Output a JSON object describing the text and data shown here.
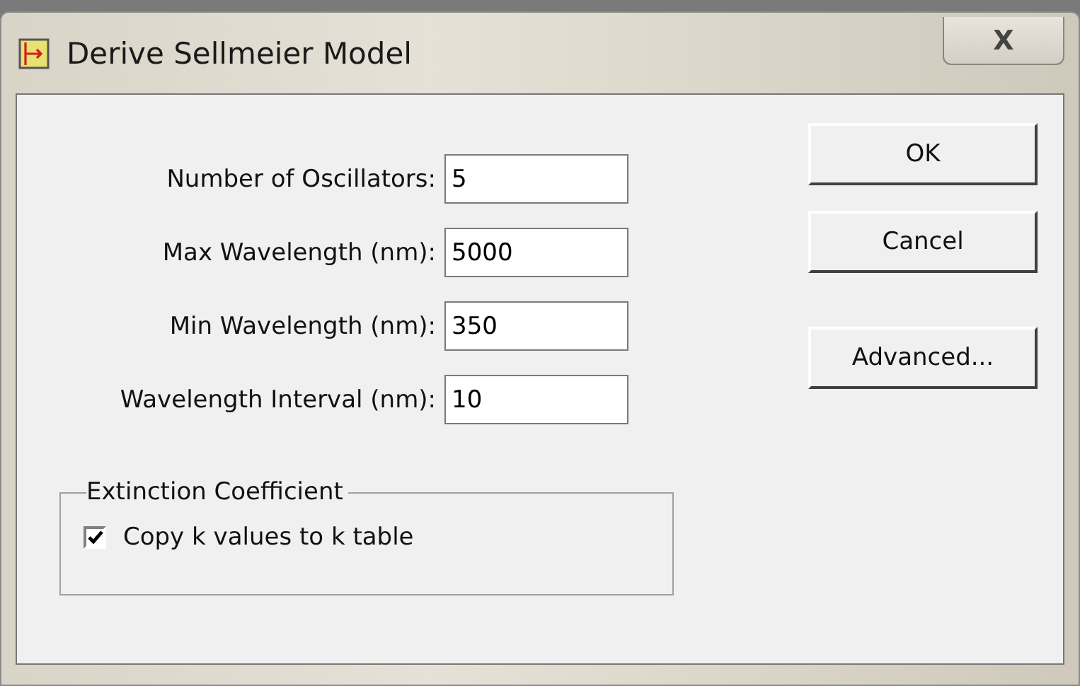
{
  "window": {
    "title": "Derive Sellmeier Model",
    "close_label": "X"
  },
  "fields": [
    {
      "label": "Number of Oscillators:",
      "value": "5"
    },
    {
      "label": "Max Wavelength (nm):",
      "value": "5000"
    },
    {
      "label": "Min Wavelength (nm):",
      "value": "350"
    },
    {
      "label": "Wavelength Interval (nm):",
      "value": "10"
    }
  ],
  "group": {
    "title": "Extinction Coefficient",
    "checkbox": {
      "label": "Copy k values to k table",
      "checked": true
    }
  },
  "buttons": [
    "OK",
    "Cancel",
    "Advanced..."
  ]
}
